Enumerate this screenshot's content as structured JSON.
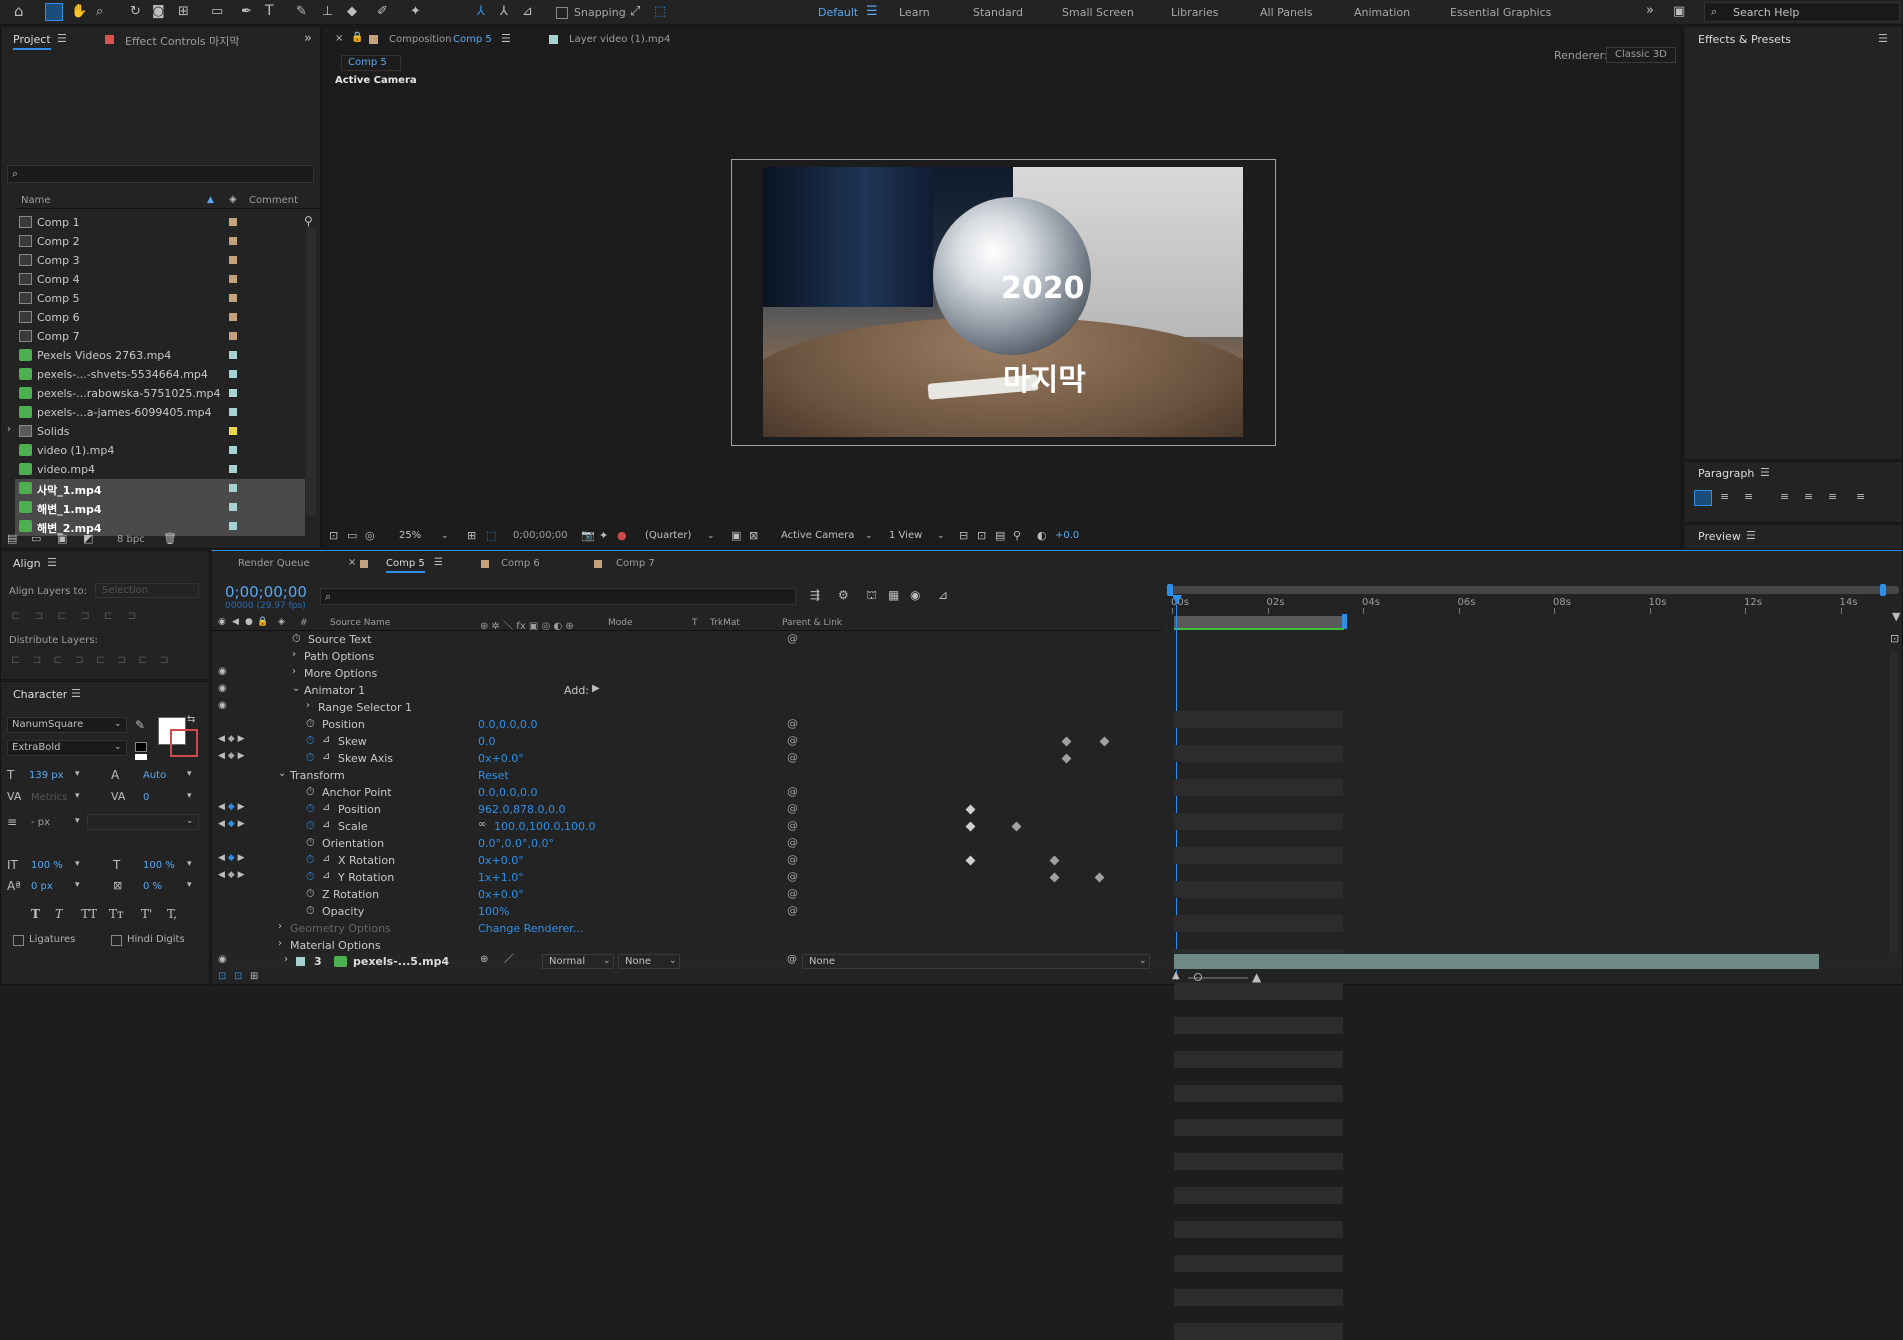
{
  "toolbar": {
    "snapping_label": "Snapping",
    "workspaces": [
      "Default",
      "Learn",
      "Standard",
      "Small Screen",
      "Libraries",
      "All Panels",
      "Animation",
      "Essential Graphics"
    ],
    "search_placeholder": "Search Help"
  },
  "project": {
    "tab_project": "Project",
    "tab_effect_controls": "Effect Controls 마지막",
    "col_name": "Name",
    "col_comment": "Comment",
    "items": [
      {
        "name": "Comp 1",
        "type": "comp",
        "color": "#c4a27d"
      },
      {
        "name": "Comp 2",
        "type": "comp",
        "color": "#c4a27d"
      },
      {
        "name": "Comp 3",
        "type": "comp",
        "color": "#c4a27d"
      },
      {
        "name": "Comp 4",
        "type": "comp",
        "color": "#c4a27d"
      },
      {
        "name": "Comp 5",
        "type": "comp",
        "color": "#c4a27d"
      },
      {
        "name": "Comp 6",
        "type": "comp",
        "color": "#c4a27d"
      },
      {
        "name": "Comp 7",
        "type": "comp",
        "color": "#c4a27d"
      },
      {
        "name": "Pexels Videos 2763.mp4",
        "type": "video",
        "color": "#a6d3d0"
      },
      {
        "name": "pexels-...-shvets-5534664.mp4",
        "type": "video",
        "color": "#a6d3d0"
      },
      {
        "name": "pexels-...rabowska-5751025.mp4",
        "type": "video",
        "color": "#a6d3d0"
      },
      {
        "name": "pexels-...a-james-6099405.mp4",
        "type": "video",
        "color": "#a6d3d0"
      },
      {
        "name": "Solids",
        "type": "folder",
        "color": "#e8d84a"
      },
      {
        "name": "video (1).mp4",
        "type": "video",
        "color": "#a6d3d0"
      },
      {
        "name": "video.mp4",
        "type": "video",
        "color": "#a6d3d0"
      },
      {
        "name": "사막_1.mp4",
        "type": "video",
        "color": "#a6d3d0"
      },
      {
        "name": "해변_1.mp4",
        "type": "video",
        "color": "#a6d3d0"
      },
      {
        "name": "해변_2.mp4",
        "type": "video",
        "color": "#a6d3d0"
      }
    ],
    "bpc": "8 bpc"
  },
  "viewer": {
    "tab_composition": "Composition",
    "tab_comp_name": "Comp 5",
    "tab_layer": "Layer video (1).mp4",
    "breadcrumb": "Comp 5",
    "renderer_label": "Renderer:",
    "renderer_value": "Classic 3D",
    "camera_label": "Active Camera",
    "text_year": "2020",
    "text_main": "마지막",
    "zoom": "25%",
    "timecode": "0;00;00;00",
    "resolution": "(Quarter)",
    "camera_select": "Active Camera",
    "view_select": "1 View",
    "exposure": "+0.0"
  },
  "effects": {
    "title": "Effects & Presets"
  },
  "paragraph": {
    "title": "Paragraph"
  },
  "preview": {
    "title": "Preview"
  },
  "align": {
    "title": "Align",
    "align_to_label": "Align Layers to:",
    "align_to_value": "Selection",
    "distribute_label": "Distribute Layers:"
  },
  "character": {
    "title": "Character",
    "font": "NanumSquare",
    "style": "ExtraBold",
    "size": "139 px",
    "leading": "Auto",
    "kerning": "Metrics",
    "tracking": "0",
    "stroke": "- px",
    "vscale": "100 %",
    "hscale": "100 %",
    "baseline": "0 px",
    "tsume": "0 %",
    "styles": [
      "T",
      "T",
      "TT",
      "Tт",
      "T'",
      "T,"
    ],
    "ligatures": "Ligatures",
    "hindi": "Hindi Digits"
  },
  "timeline": {
    "tabs": [
      "Render Queue",
      "Comp 5",
      "Comp 6",
      "Comp 7"
    ],
    "timecode": "0;00;00;00",
    "fps": "00000 (29.97 fps)",
    "columns": {
      "source": "Source Name",
      "mode": "Mode",
      "t": "T",
      "trkmat": "TrkMat",
      "parent": "Parent & Link"
    },
    "ruler": [
      "00s",
      "02s",
      "04s",
      "06s",
      "08s",
      "10s",
      "12s",
      "14s"
    ],
    "rows": [
      {
        "name": "Source Text",
        "indent": 1,
        "value": "",
        "stopwatch": true,
        "spiral": true
      },
      {
        "name": "Path Options",
        "indent": 1,
        "value": "",
        "arrow": true
      },
      {
        "name": "More Options",
        "indent": 1,
        "value": "",
        "arrow": true
      },
      {
        "name": "Animator 1",
        "indent": 1,
        "value": "",
        "arrow": true,
        "open": true,
        "add": "Add:"
      },
      {
        "name": "Range Selector 1",
        "indent": 2,
        "value": "",
        "arrow": true
      },
      {
        "name": "Position",
        "indent": 2,
        "value": "0.0,0.0,0.0",
        "stopwatch": true,
        "spiral": true
      },
      {
        "name": "Skew",
        "indent": 2,
        "value": "0.0",
        "stopwatch": true,
        "graph": true,
        "spiral": true,
        "nav": true
      },
      {
        "name": "Skew Axis",
        "indent": 2,
        "value": "0x+0.0°",
        "stopwatch": true,
        "graph": true,
        "spiral": true,
        "nav": true
      },
      {
        "name": "Transform",
        "indent": 0,
        "value": "Reset",
        "arrow": true,
        "open": true
      },
      {
        "name": "Anchor Point",
        "indent": 2,
        "value": "0.0,0.0,0.0",
        "stopwatch": true,
        "spiral": true
      },
      {
        "name": "Position",
        "indent": 2,
        "value": "962.0,878.0,0.0",
        "stopwatch": true,
        "graph": true,
        "spiral": true,
        "nav": true,
        "blue_kf": true
      },
      {
        "name": "Scale",
        "indent": 2,
        "value": "100.0,100.0,100.0",
        "stopwatch": true,
        "graph": true,
        "spiral": true,
        "nav": true,
        "blue_kf": true,
        "link": true
      },
      {
        "name": "Orientation",
        "indent": 2,
        "value": "0.0°,0.0°,0.0°",
        "stopwatch": true,
        "spiral": true
      },
      {
        "name": "X Rotation",
        "indent": 2,
        "value": "0x+0.0°",
        "stopwatch": true,
        "graph": true,
        "spiral": true,
        "nav": true,
        "blue_kf": true
      },
      {
        "name": "Y Rotation",
        "indent": 2,
        "value": "1x+1.0°",
        "stopwatch": true,
        "graph": true,
        "spiral": true,
        "nav": true
      },
      {
        "name": "Z Rotation",
        "indent": 2,
        "value": "0x+0.0°",
        "stopwatch": true,
        "spiral": true
      },
      {
        "name": "Opacity",
        "indent": 2,
        "value": "100%",
        "stopwatch": true,
        "spiral": true
      },
      {
        "name": "Geometry Options",
        "indent": 0,
        "value": "Change Renderer...",
        "arrow": true,
        "dim": true
      },
      {
        "name": "Material Options",
        "indent": 0,
        "value": "",
        "arrow": true
      }
    ],
    "layer_row": {
      "number": "3",
      "name": "pexels-...5.mp4",
      "mode": "Normal",
      "trkmat": "None",
      "parent": "None"
    }
  }
}
